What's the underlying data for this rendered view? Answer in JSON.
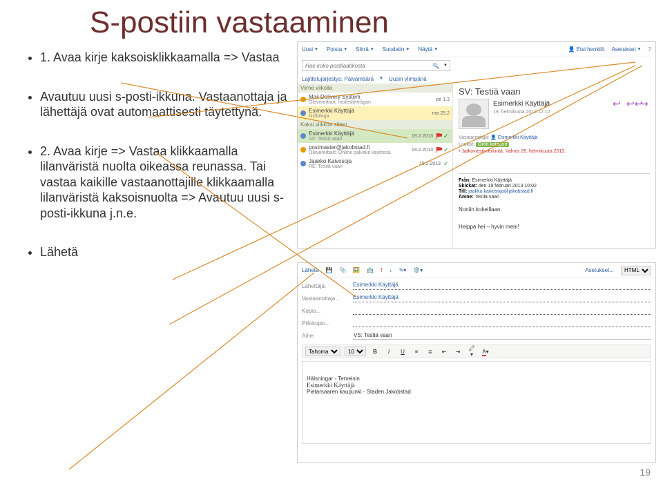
{
  "title": "S-postiin vastaaminen",
  "slide_number": "19",
  "bullets": {
    "b1": "1. Avaa kirje kaksoisklikkaamalla => Vastaa",
    "b2": "Avautuu uusi s-posti-ikkuna. Vastaanottaja ja lähettäjä ovat automaattisesti täytettynä.",
    "b3": "2. Avaa kirje => Vastaa klikkaamalla lilanväristä nuolta oikeassa reunassa. Tai vastaa kaikille vastaanottajille klikkaamalla lilanväristä kaksoisnuolta => Avautuu uusi s-posti-ikkuna j.n.e.",
    "b4": "Lähetä"
  },
  "shot1": {
    "toolbar": {
      "new": "Uusi",
      "delete": "Poista",
      "move": "Siirrä",
      "filter": "Suodatin",
      "view": "Näytä",
      "search_person": "Etsi henkilö",
      "settings": "Asetukset"
    },
    "search_placeholder": "Hae koko postilaatikosta",
    "sort": {
      "label": "Lajittelujärjestys: Päivämäärä",
      "order": "Uusin ylimpänä"
    },
    "groups": {
      "g1": "Viime viikolla",
      "g2": "Kaksi viikkoa sitten"
    },
    "rows": [
      {
        "name": "Mail Delivery System",
        "sub": "Olevererbart: motesförfrågan",
        "date": "pe 1.3"
      },
      {
        "name": "Esimerkki Käyttäjä",
        "sub": "biidbilaga",
        "date": "ma 25.2"
      },
      {
        "name": "Esimerkki Käyttäjä",
        "sub": "SV: Testiä vaan",
        "date": "19.2.2013"
      },
      {
        "name": "postmaster@jakobstad.fi",
        "sub": "Olevererbart: Online palvelut käytössä",
        "date": "19.2.2013"
      },
      {
        "name": "Jaakko Kaivosoja",
        "sub": "RE: Testiä vaan",
        "date": "19.2.2013"
      }
    ],
    "pane": {
      "subject": "SV: Testiä vaan",
      "sender": "Esimerkki Käyttäjä",
      "sent": "19. helmikuuta 2013 12:12",
      "to_lbl": "Vastaanottaja:",
      "to": "Esimerkki Käyttäjä",
      "cat_lbl": "Luokat:",
      "cat": "Grön kategori",
      "note": "Jatkoviestimerkintä. Valmis 28. helmikuuta 2013.",
      "from_lbl": "Från:",
      "from": "Esimerkki Käyttäjä",
      "sent2_lbl": "Skickat:",
      "sent2": "den 19 februari 2013 10:02",
      "till_lbl": "Till:",
      "till": "jaakko.kaivosoja@jakobstad.fi",
      "amne_lbl": "Ämne:",
      "amne": "Testiä vaan",
      "body1": "Noniin kokeillaan.",
      "body2": "Heippa hei – hyvin meni!"
    }
  },
  "shot2": {
    "toolbar": {
      "send": "Lähetä",
      "settings": "Asetukset...",
      "format": "HTML"
    },
    "fields": {
      "from_lbl": "Lähettäjä:",
      "from": "Esimerkki Käyttäjä",
      "to_lbl": "Vastaanottaja...",
      "to": "Esimerkki Käyttäjä",
      "cc_lbl": "Kopio...",
      "bcc_lbl": "Piilokopio...",
      "subj_lbl": "Aihe:",
      "subj": "VS: Testiä vaan"
    },
    "fmt": {
      "font": "Tahoma",
      "size": "10"
    },
    "body": {
      "greet": "Hälsningar - Terveisin",
      "sig": "Esimerkki Käyttäjä",
      "org": "Pietarsaaren kaupunki - Staden Jakobstad"
    }
  }
}
